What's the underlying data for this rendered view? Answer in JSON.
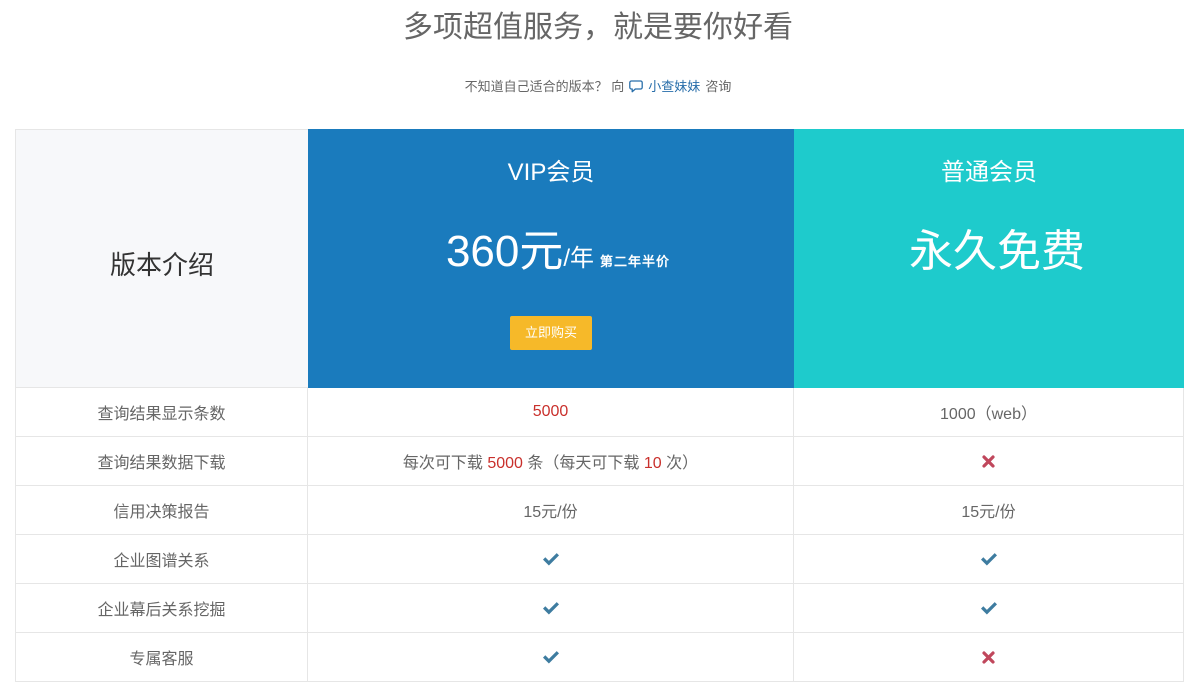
{
  "page": {
    "title": "多项超值服务，就是要你好看",
    "hint": {
      "prefix": "不知道自己适合的版本？ 向",
      "link_icon": "chat-icon",
      "link_text": "小查妹妹",
      "suffix": "咨询"
    }
  },
  "pricing": {
    "intro_label": "版本介绍",
    "vip": {
      "name": "VIP会员",
      "price_amount": "360元",
      "price_unit": "/年",
      "price_note": "第二年半价",
      "buy_label": "立即购买"
    },
    "basic": {
      "name": "普通会员",
      "price": "永久免费"
    },
    "features": [
      {
        "name": "查询结果显示条数",
        "vip": {
          "segments": [
            {
              "text": "5000",
              "highlight": true
            }
          ]
        },
        "basic": {
          "segments": [
            {
              "text": "1000（web）",
              "highlight": false
            }
          ]
        }
      },
      {
        "name": "查询结果数据下载",
        "vip": {
          "segments": [
            {
              "text": "每次可下载 ",
              "highlight": false
            },
            {
              "text": "5000",
              "highlight": true
            },
            {
              "text": " 条（每天可下载 ",
              "highlight": false
            },
            {
              "text": "10",
              "highlight": true
            },
            {
              "text": " 次）",
              "highlight": false
            }
          ]
        },
        "basic": {
          "icon": "cross-icon"
        }
      },
      {
        "name": "信用决策报告",
        "vip": {
          "segments": [
            {
              "text": "15元/份",
              "highlight": false
            }
          ]
        },
        "basic": {
          "segments": [
            {
              "text": "15元/份",
              "highlight": false
            }
          ]
        }
      },
      {
        "name": "企业图谱关系",
        "vip": {
          "icon": "check-icon"
        },
        "basic": {
          "icon": "check-icon"
        }
      },
      {
        "name": "企业幕后关系挖掘",
        "vip": {
          "icon": "check-icon"
        },
        "basic": {
          "icon": "check-icon"
        }
      },
      {
        "name": "专属客服",
        "vip": {
          "icon": "check-icon"
        },
        "basic": {
          "icon": "cross-icon"
        }
      }
    ]
  },
  "colors": {
    "vip_header": "#1a7bbd",
    "basic_header": "#1ecbcc",
    "buy_button": "#f6b929",
    "highlight": "#c9302c",
    "check": "#3e7ca0",
    "cross": "#c0475c",
    "link": "#286eaa",
    "intro_header_bg": "#f7f8fa"
  }
}
